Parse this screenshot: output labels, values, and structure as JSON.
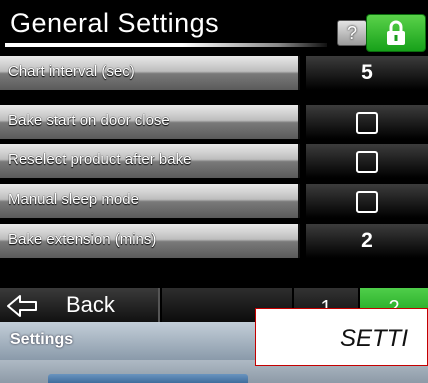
{
  "header": {
    "title": "General Settings",
    "help_label": "?",
    "accent_color": "#22b020"
  },
  "settings": [
    {
      "label": "Chart interval (sec)",
      "type": "number",
      "value": "5"
    },
    {
      "label": "Bake start on door close",
      "type": "checkbox",
      "checked": false
    },
    {
      "label": "Reselect product after bake",
      "type": "checkbox",
      "checked": false
    },
    {
      "label": "Manual sleep mode",
      "type": "checkbox",
      "checked": false
    },
    {
      "label": "Bake extension (mins)",
      "type": "number",
      "value": "2"
    }
  ],
  "nav": {
    "back_label": "Back",
    "pages": [
      "1",
      "2"
    ],
    "current_page": "2"
  },
  "breadcrumb": {
    "label": "Settings"
  },
  "overlay": {
    "text": "SETTI"
  }
}
